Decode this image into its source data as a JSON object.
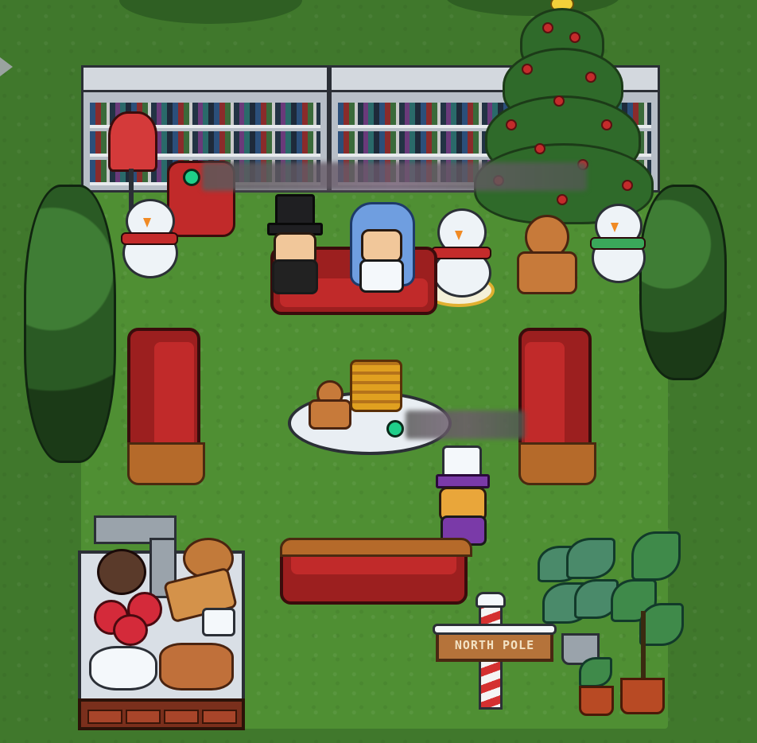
{
  "scene": {
    "type": "pixel-art virtual office room",
    "theme": "Christmas living room"
  },
  "signpost": {
    "text": "NORTH POLE"
  },
  "players": [
    {
      "id": "player-1",
      "status_color": "#1fcf8a"
    },
    {
      "id": "player-2",
      "status_color": "#1fcf8a"
    }
  ],
  "colors": {
    "grass_outer": "#40782c",
    "grass_room": "#4f8f33",
    "sofa_red": "#9c1f1f",
    "status_online": "#1fcf8a"
  }
}
